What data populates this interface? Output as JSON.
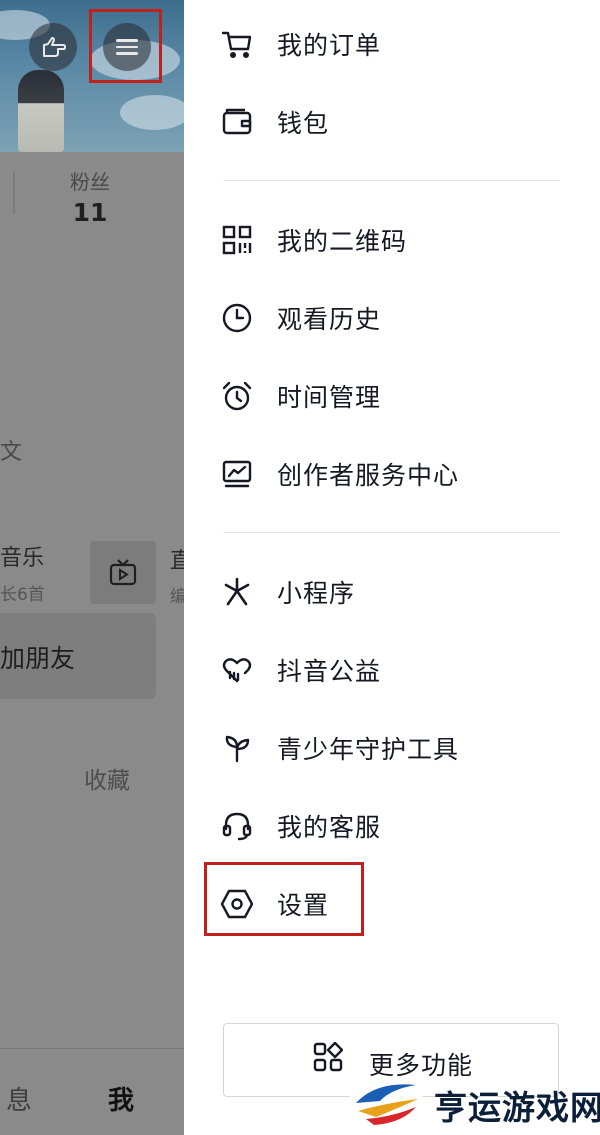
{
  "background": {
    "fans_label": "粉丝",
    "fans_count": "11",
    "edit_partial": "文",
    "music_label": "音乐",
    "music_sub": "长6首",
    "partial_right1": "直",
    "partial_right2": "编",
    "add_friend": "加朋友",
    "favorites": "收藏",
    "nav_messages": "息",
    "nav_me": "我"
  },
  "menu": {
    "orders": "我的订单",
    "wallet": "钱包",
    "qr_code": "我的二维码",
    "history": "观看历史",
    "time_manage": "时间管理",
    "creator_center": "创作者服务中心",
    "mini_programs": "小程序",
    "charity": "抖音公益",
    "youth_protection": "青少年守护工具",
    "customer_service": "我的客服",
    "settings": "设置",
    "more_features": "更多功能"
  },
  "highlight_color": "#c0211f",
  "watermark": {
    "text": "亨运游戏网",
    "brand_colors": [
      "#1a5fb4",
      "#e8a21a",
      "#d7262c"
    ]
  }
}
